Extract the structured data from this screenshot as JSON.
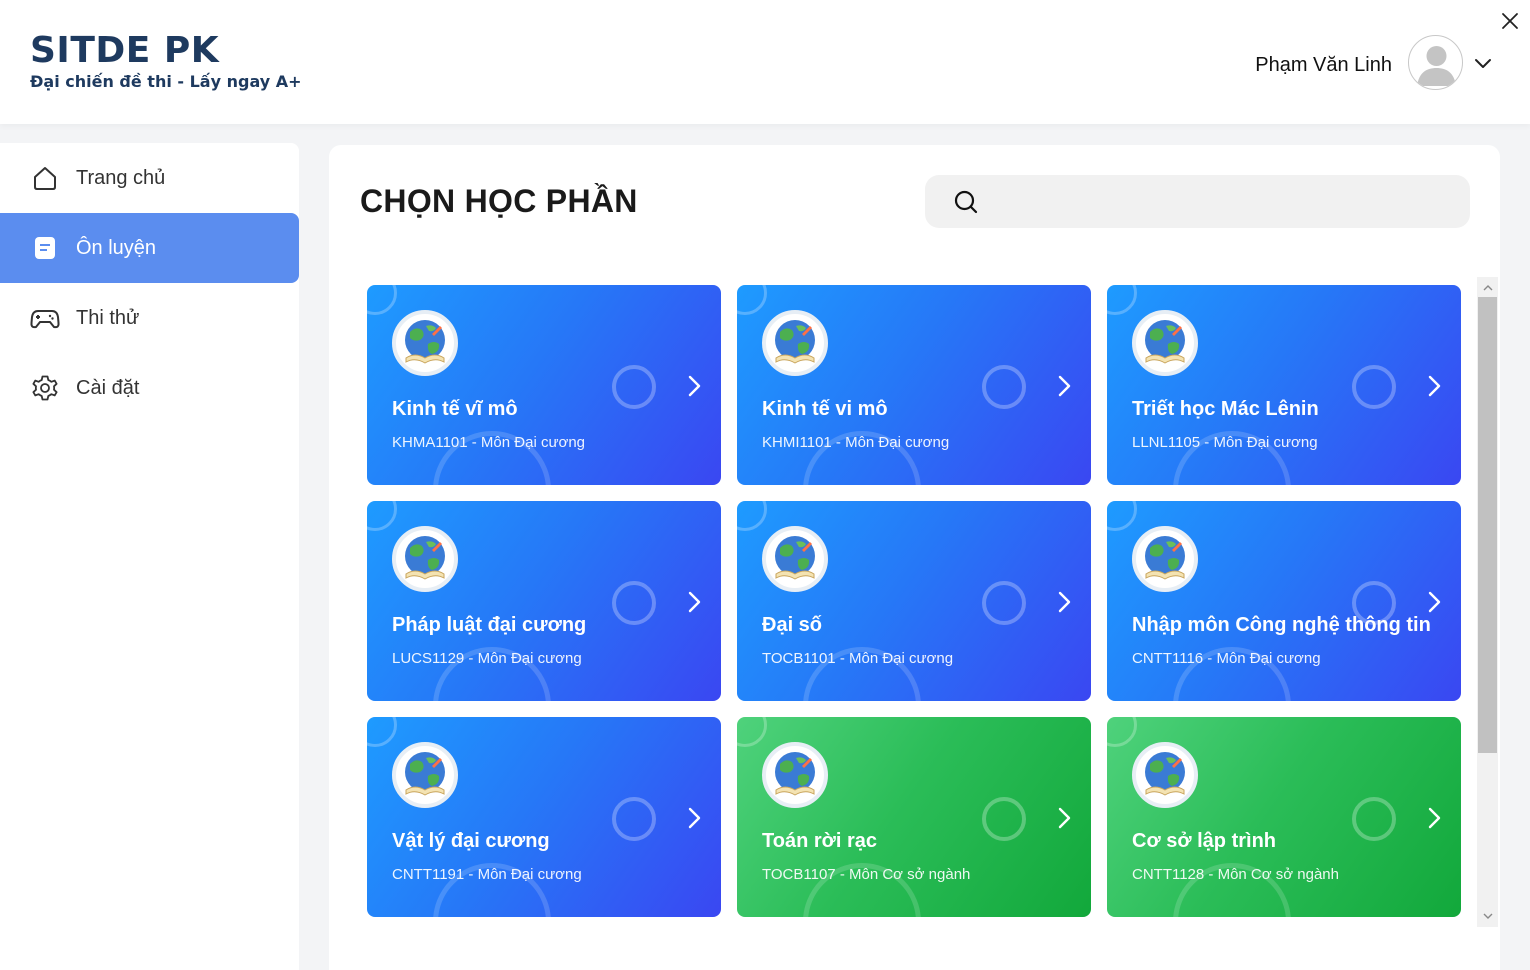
{
  "brand": {
    "title": "SITDE PK",
    "subtitle": "Đại chiến đề thi - Lấy ngay A+"
  },
  "user": {
    "name": "Phạm Văn Linh"
  },
  "sidebar": {
    "items": [
      {
        "label": "Trang chủ",
        "icon": "home-icon",
        "active": false
      },
      {
        "label": "Ôn luyện",
        "icon": "document-icon",
        "active": true
      },
      {
        "label": "Thi thử",
        "icon": "gamepad-icon",
        "active": false
      },
      {
        "label": "Cài đặt",
        "icon": "gear-icon",
        "active": false
      }
    ]
  },
  "main": {
    "title": "CHỌN HỌC PHẦN",
    "search": {
      "value": "",
      "placeholder": ""
    }
  },
  "courses": [
    {
      "name": "Kinh tế vĩ mô",
      "code": "KHMA1101 - Môn Đại cương",
      "color": "blue"
    },
    {
      "name": "Kinh tế vi mô",
      "code": "KHMI1101 - Môn Đại cương",
      "color": "blue"
    },
    {
      "name": "Triết học Mác Lênin",
      "code": "LLNL1105 - Môn Đại cương",
      "color": "blue"
    },
    {
      "name": "Pháp luật đại cương",
      "code": "LUCS1129 - Môn Đại cương",
      "color": "blue"
    },
    {
      "name": "Đại số",
      "code": "TOCB1101 - Môn Đại cương",
      "color": "blue"
    },
    {
      "name": "Nhập môn Công nghệ thông tin",
      "code": "CNTT1116 - Môn Đại cương",
      "color": "blue"
    },
    {
      "name": "Vật lý đại cương",
      "code": "CNTT1191 - Môn Đại cương",
      "color": "blue"
    },
    {
      "name": "Toán rời rạc",
      "code": "TOCB1107 - Môn Cơ sở ngành",
      "color": "green"
    },
    {
      "name": "Cơ sở lập trình",
      "code": "CNTT1128 - Môn Cơ sở ngành",
      "color": "green"
    }
  ],
  "colors": {
    "blue_start": "#1e9bff",
    "blue_end": "#3a47f2",
    "green_start": "#4fd27c",
    "green_end": "#12a83b",
    "active_nav": "#5b8def",
    "brand": "#1e3a5f"
  }
}
